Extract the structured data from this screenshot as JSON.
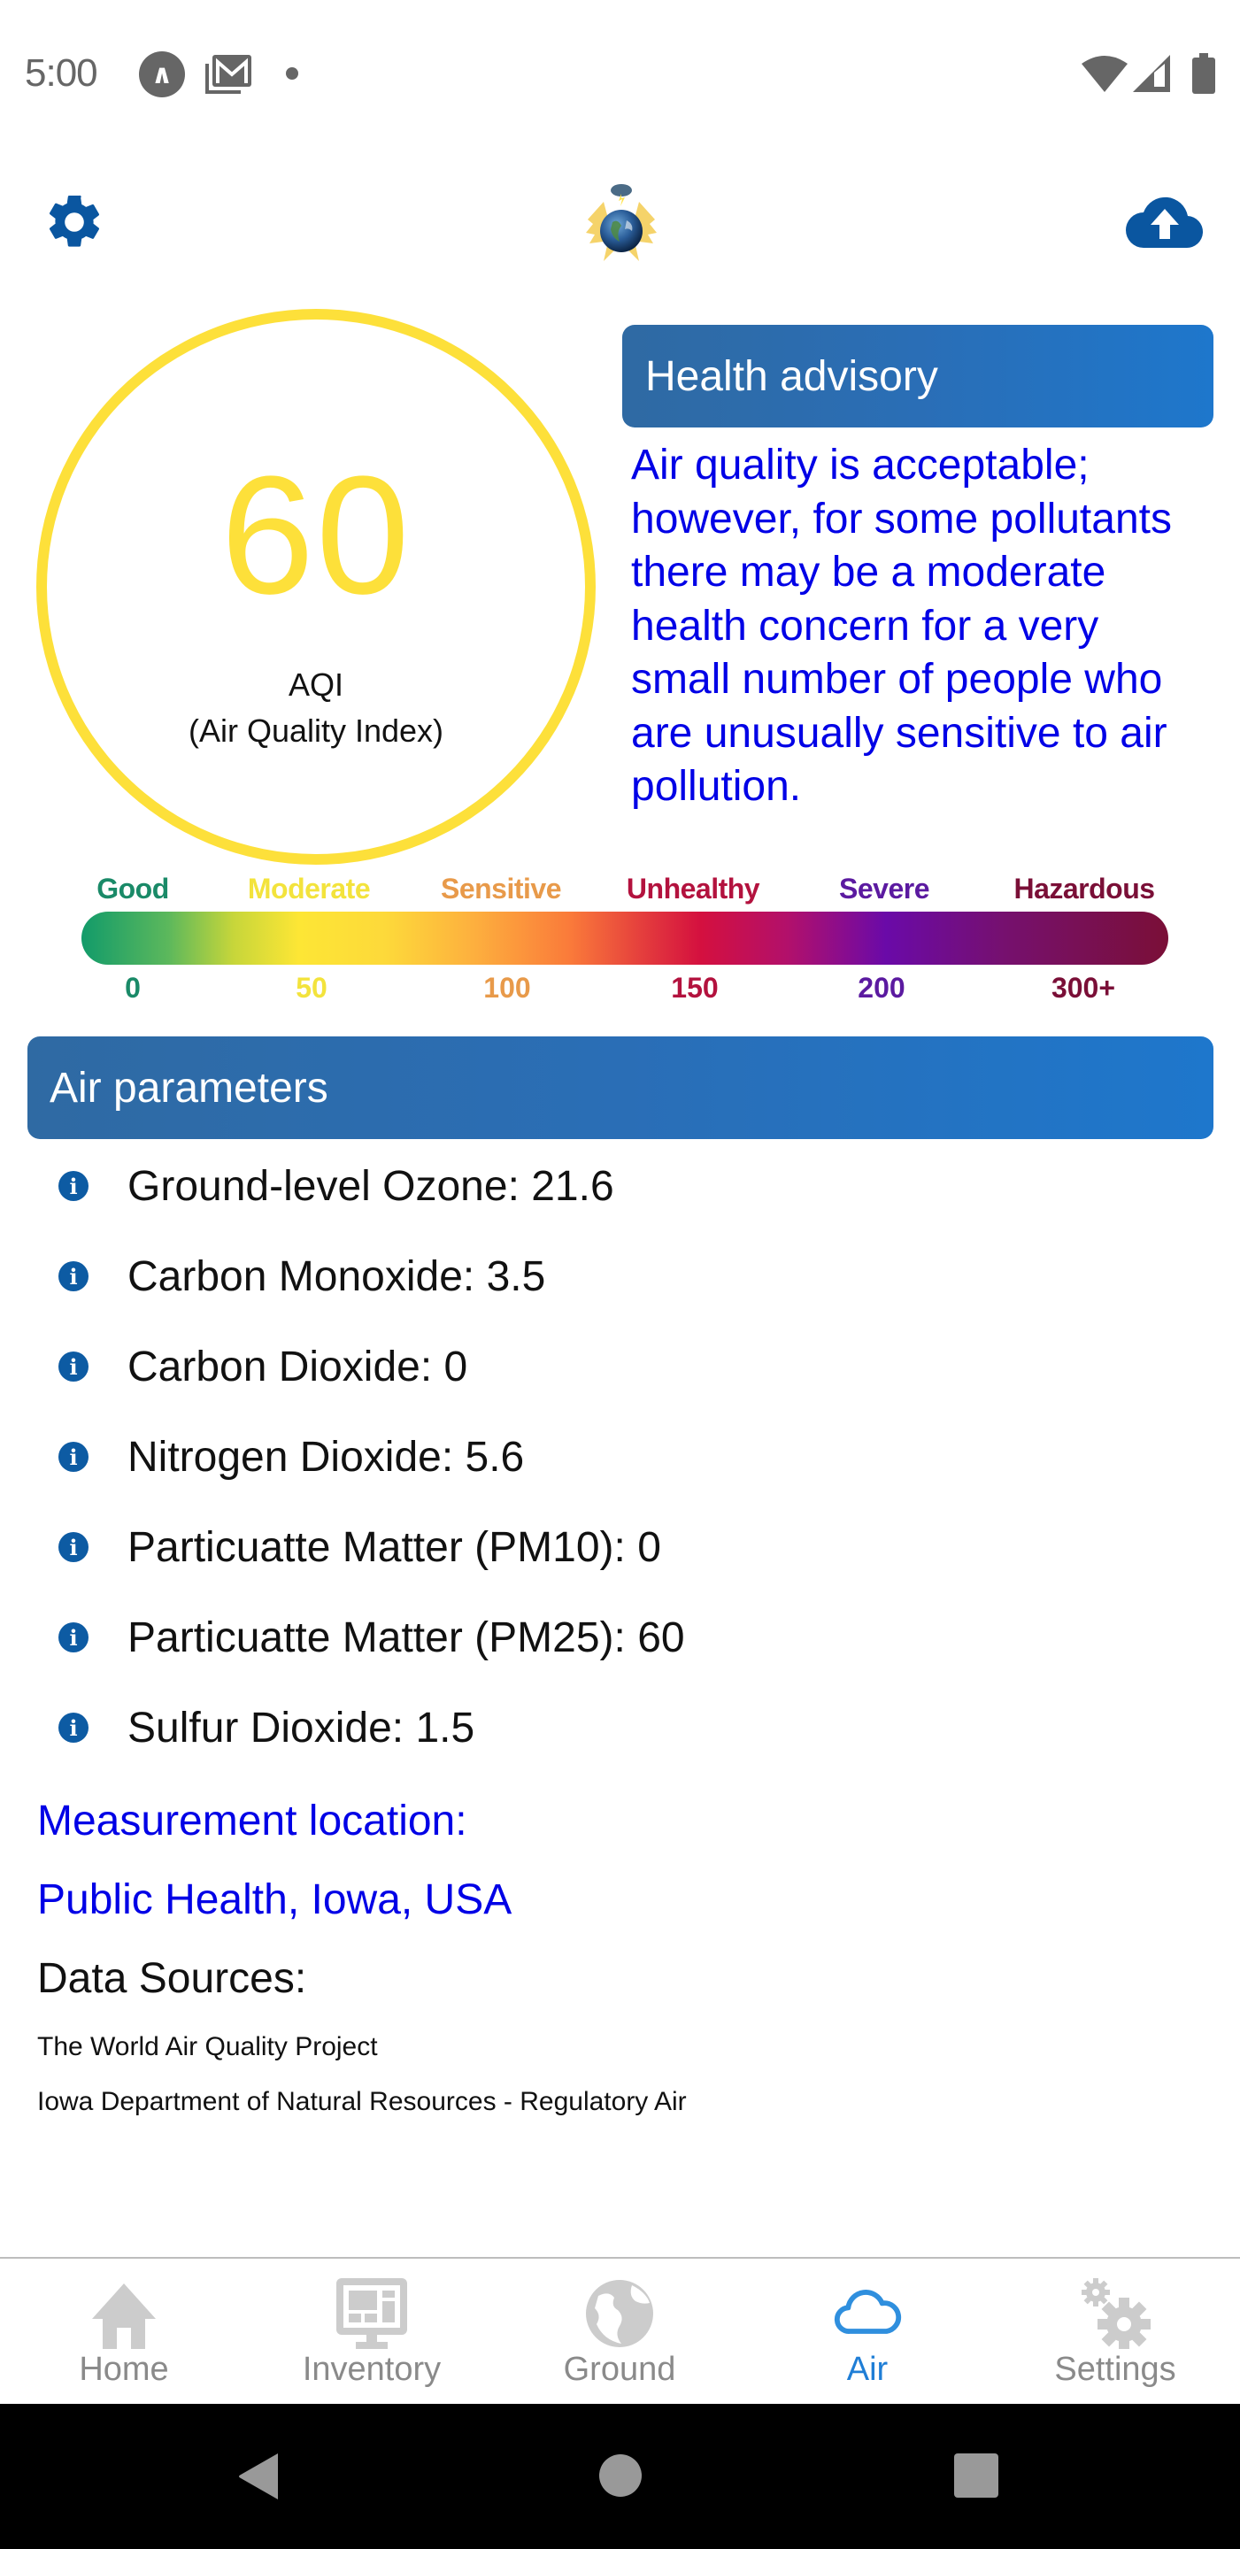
{
  "status_bar": {
    "time": "5:00",
    "icons": [
      "a-notification-icon",
      "gmail-icon",
      "notification-dot-icon",
      "wifi-icon",
      "cell-signal-icon",
      "battery-icon"
    ]
  },
  "top_bar": {
    "left_icon": "gear-icon",
    "center_icon": "earth-wings-logo",
    "right_icon": "cloud-upload-icon"
  },
  "aqi": {
    "value": "60",
    "label_line1": "AQI",
    "label_line2": "(Air Quality Index)",
    "color": "#fde03a"
  },
  "health_advisory": {
    "title": "Health advisory",
    "text": "Air quality is acceptable; however, for some pollutants there may be a moderate health concern for a very small number of people who are unusually sensitive to air pollution.",
    "text_color": "#0000e6"
  },
  "aqi_scale": {
    "categories": [
      {
        "label": "Good",
        "value": "0",
        "color": "#1a8a68"
      },
      {
        "label": "Moderate",
        "value": "50",
        "color": "#f3e33c"
      },
      {
        "label": "Sensitive",
        "value": "100",
        "color": "#e89a4a"
      },
      {
        "label": "Unhealthy",
        "value": "150",
        "color": "#b3123e"
      },
      {
        "label": "Severe",
        "value": "200",
        "color": "#5b1aa0"
      },
      {
        "label": "Hazardous",
        "value": "300+",
        "color": "#7a0f37"
      }
    ]
  },
  "air_parameters": {
    "title": "Air parameters",
    "items": [
      {
        "text": "Ground-level Ozone: 21.6",
        "name": "Ground-level Ozone",
        "value": "21.6"
      },
      {
        "text": "Carbon Monoxide: 3.5",
        "name": "Carbon Monoxide",
        "value": "3.5"
      },
      {
        "text": "Carbon Dioxide: 0",
        "name": "Carbon Dioxide",
        "value": "0"
      },
      {
        "text": "Nitrogen Dioxide: 5.6",
        "name": "Nitrogen Dioxide",
        "value": "5.6"
      },
      {
        "text": "Particuatte Matter (PM10): 0",
        "name": "Particuatte Matter (PM10)",
        "value": "0"
      },
      {
        "text": "Particuatte Matter (PM25): 60",
        "name": "Particuatte Matter (PM25)",
        "value": "60"
      },
      {
        "text": "Sulfur Dioxide: 1.5",
        "name": "Sulfur Dioxide",
        "value": "1.5"
      }
    ]
  },
  "location": {
    "label": "Measurement location:",
    "value": "Public Health, Iowa, USA"
  },
  "data_sources": {
    "title": "Data Sources:",
    "items": [
      "The World Air Quality Project",
      "Iowa Department of Natural Resources - Regulatory Air"
    ]
  },
  "bottom_nav": {
    "active": "Air",
    "active_color": "#1f7ed6",
    "items": [
      {
        "label": "Home",
        "icon": "home-icon"
      },
      {
        "label": "Inventory",
        "icon": "monitor-icon"
      },
      {
        "label": "Ground",
        "icon": "globe-icon"
      },
      {
        "label": "Air",
        "icon": "cloud-icon"
      },
      {
        "label": "Settings",
        "icon": "gears-icon"
      }
    ]
  },
  "system_nav": {
    "buttons": [
      "back",
      "home",
      "recents"
    ]
  }
}
